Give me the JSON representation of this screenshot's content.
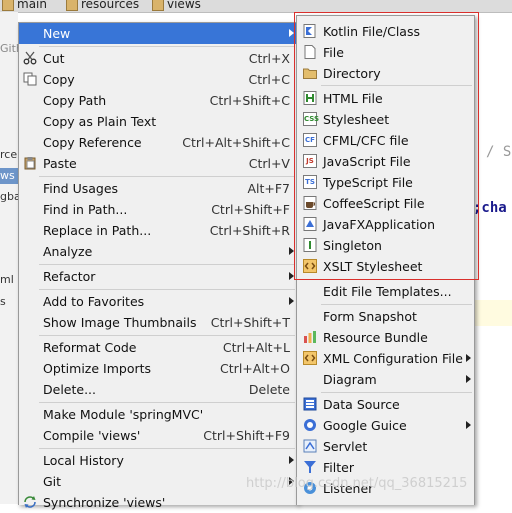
{
  "breadcrumbs": [
    "main",
    "resources",
    "views"
  ],
  "background": {
    "left_fragments": [
      "Gith",
      "rce",
      "ws",
      "gba",
      "ml",
      "s"
    ],
    "code_fragments": [
      "/ S",
      ";cha"
    ]
  },
  "watermark": "http://blog.csdn.net/qq_36815215",
  "main_menu": {
    "new": "New",
    "cut": "Cut",
    "cut_sc": "Ctrl+X",
    "copy": "Copy",
    "copy_sc": "Ctrl+C",
    "copy_path": "Copy Path",
    "copy_path_sc": "Ctrl+Shift+C",
    "copy_plain": "Copy as Plain Text",
    "copy_ref": "Copy Reference",
    "copy_ref_sc": "Ctrl+Alt+Shift+C",
    "paste": "Paste",
    "paste_sc": "Ctrl+V",
    "find_usages": "Find Usages",
    "find_usages_sc": "Alt+F7",
    "find_in_path": "Find in Path...",
    "find_in_path_sc": "Ctrl+Shift+F",
    "replace_in_path": "Replace in Path...",
    "replace_in_path_sc": "Ctrl+Shift+R",
    "analyze": "Analyze",
    "refactor": "Refactor",
    "add_favorites": "Add to Favorites",
    "show_thumbs": "Show Image Thumbnails",
    "show_thumbs_sc": "Ctrl+Shift+T",
    "reformat": "Reformat Code",
    "reformat_sc": "Ctrl+Alt+L",
    "optimize": "Optimize Imports",
    "optimize_sc": "Ctrl+Alt+O",
    "delete": "Delete...",
    "delete_sc": "Delete",
    "make_module": "Make Module 'springMVC'",
    "compile": "Compile 'views'",
    "compile_sc": "Ctrl+Shift+F9",
    "local_history": "Local History",
    "git": "Git",
    "synchronize": "Synchronize 'views'"
  },
  "sub_menu": {
    "kotlin": "Kotlin File/Class",
    "file": "File",
    "directory": "Directory",
    "html": "HTML File",
    "stylesheet": "Stylesheet",
    "cfml": "CFML/CFC file",
    "javascript": "JavaScript File",
    "typescript": "TypeScript File",
    "coffeescript": "CoffeeScript File",
    "javafx": "JavaFXApplication",
    "singleton": "Singleton",
    "xslt": "XSLT Stylesheet",
    "edit_templates": "Edit File Templates...",
    "form_snapshot": "Form Snapshot",
    "resource_bundle": "Resource Bundle",
    "xml_config": "XML Configuration File",
    "diagram": "Diagram",
    "data_source": "Data Source",
    "google_guice": "Google Guice",
    "servlet": "Servlet",
    "filter": "Filter",
    "listener": "Listener"
  },
  "icon_labels": {
    "css": "CSS",
    "cf": "CF",
    "js": "JS",
    "ts": "TS"
  },
  "colors": {
    "selection": "#3875d7",
    "highlight_box": "#d9302c",
    "menu_bg": "#f0f0f0"
  }
}
